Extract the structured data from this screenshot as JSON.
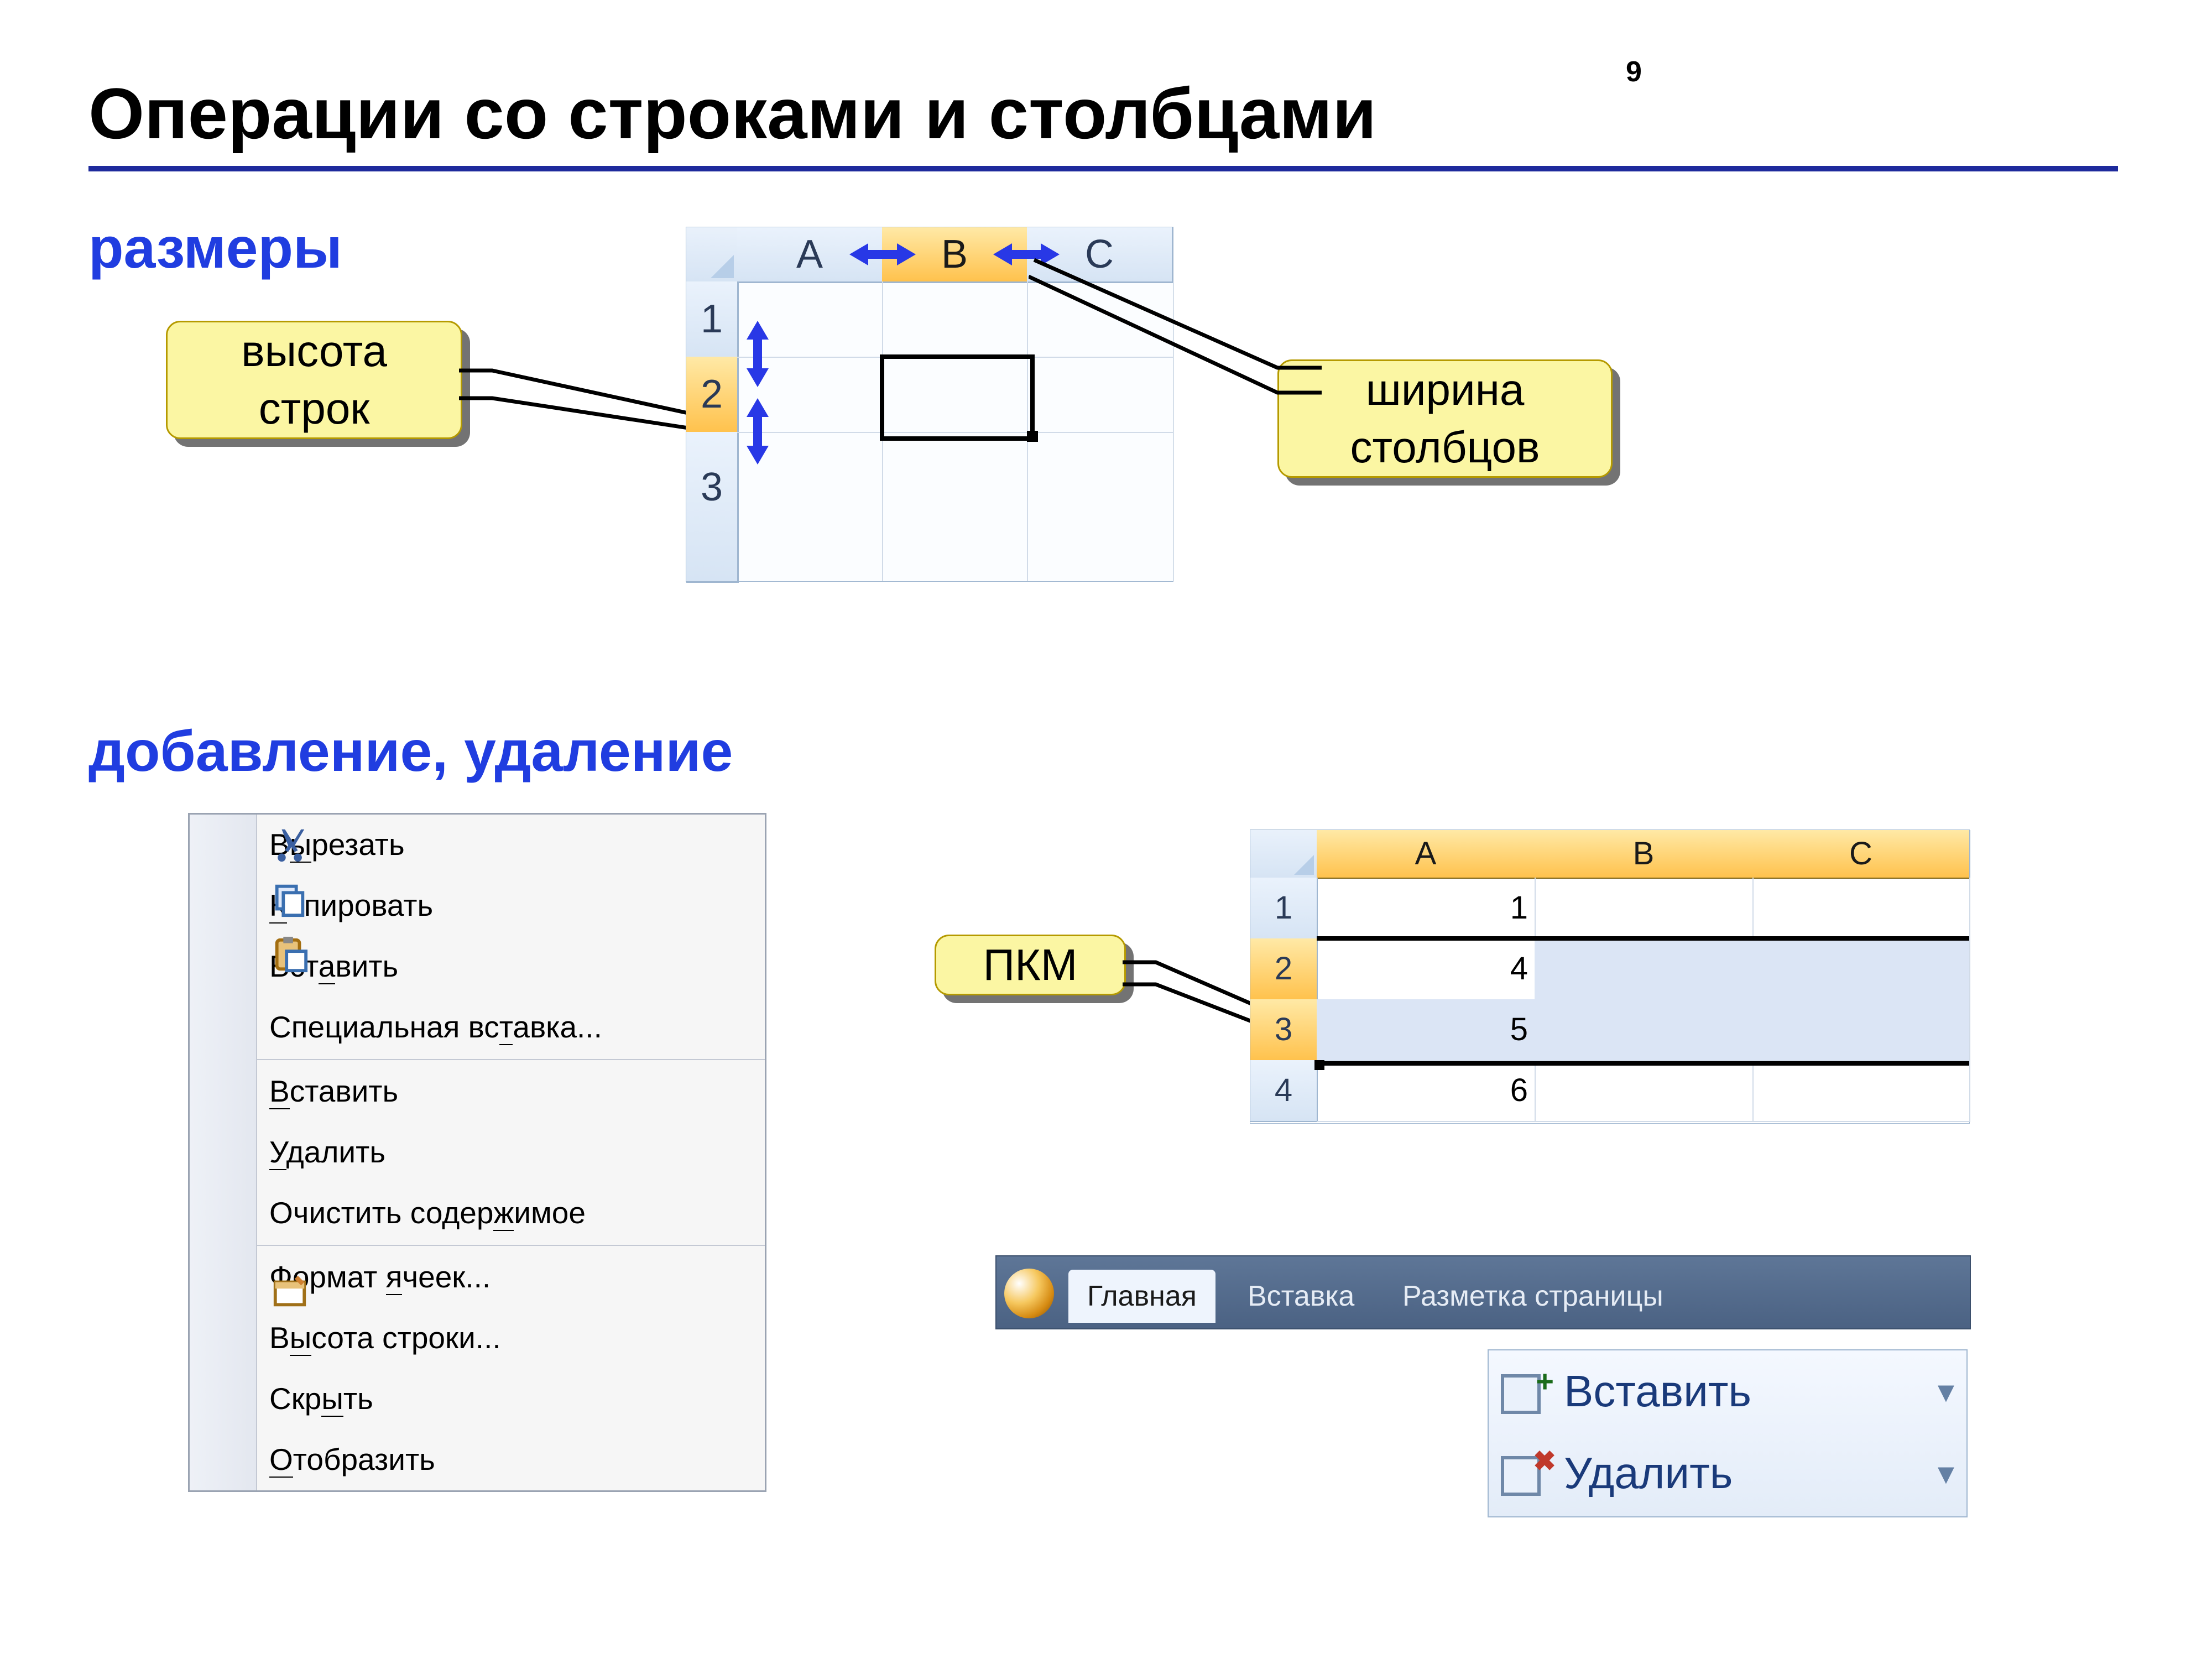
{
  "page_number": "9",
  "title": "Операции со строками и столбцами",
  "sections": {
    "sizes": "размеры",
    "addrem": "добавление, удаление"
  },
  "callouts": {
    "row_height_l1": "высота",
    "row_height_l2": "строк",
    "col_width_l1": "ширина",
    "col_width_l2": "столбцов",
    "rmb": "ПКМ"
  },
  "sheet1": {
    "cols": [
      "A",
      "B",
      "C"
    ],
    "rows": [
      "1",
      "2",
      "3"
    ]
  },
  "sheet2": {
    "cols": [
      "A",
      "B",
      "C"
    ],
    "rows": [
      "1",
      "2",
      "3",
      "4"
    ],
    "colA": [
      "1",
      "4",
      "5",
      "6"
    ]
  },
  "context_menu": {
    "cut": "Вырезать",
    "copy": "Копировать",
    "paste": "Вставить",
    "paste_special": "Специальная вставка...",
    "insert": "Вставить",
    "delete": "Удалить",
    "clear": "Очистить содержимое",
    "format_cells": "Формат ячеек...",
    "row_height": "Высота строки...",
    "hide": "Скрыть",
    "show": "Отобразить"
  },
  "ribbon": {
    "tabs": {
      "home": "Главная",
      "insert": "Вставка",
      "layout": "Разметка страницы"
    },
    "cells": {
      "insert": "Вставить",
      "delete": "Удалить"
    }
  }
}
